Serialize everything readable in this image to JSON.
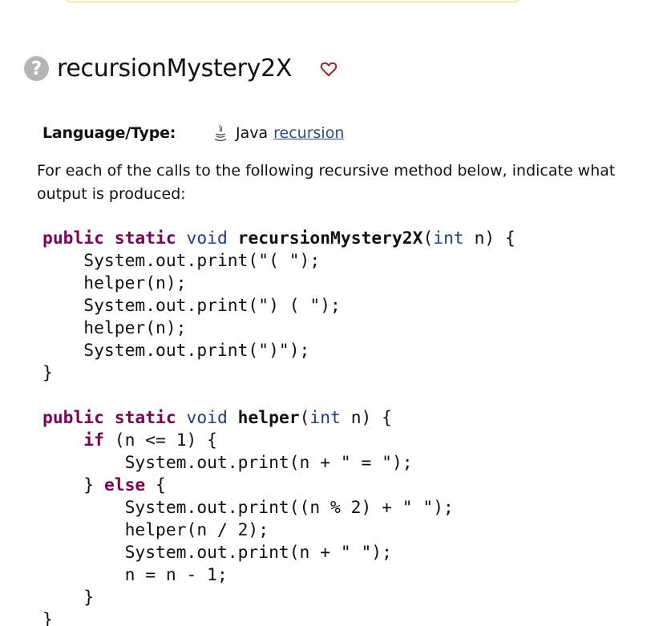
{
  "title": "recursionMystery2X",
  "meta": {
    "label": "Language/Type:",
    "language": "Java",
    "topic": "recursion"
  },
  "description": "For each of the calls to the following recursive method below, indicate what output is produced:",
  "code": {
    "method1_signature": {
      "k1": "public",
      "k2": "static",
      "ret": "void",
      "name": "recursionMystery2X",
      "ptype": "int",
      "rest": " n) {"
    },
    "method1_body": [
      "    System.out.print(\"( \");",
      "    helper(n);",
      "    System.out.print(\") ( \");",
      "    helper(n);",
      "    System.out.print(\")\");"
    ],
    "close1": "}",
    "method2_signature": {
      "k1": "public",
      "k2": "static",
      "ret": "void",
      "name": "helper",
      "ptype": "int",
      "rest": " n) {"
    },
    "if_kw": "if",
    "if_rest": " (n <= 1) {",
    "if_body": "        System.out.print(n + \" = \");",
    "else_open": "    } ",
    "else_kw": "else",
    "else_rest": " {",
    "else_body": [
      "        System.out.print((n % 2) + \" \");",
      "        helper(n / 2);",
      "        System.out.print(n + \" \");",
      "        n = n - 1;"
    ],
    "inner_close": "    }",
    "close2": "}"
  }
}
